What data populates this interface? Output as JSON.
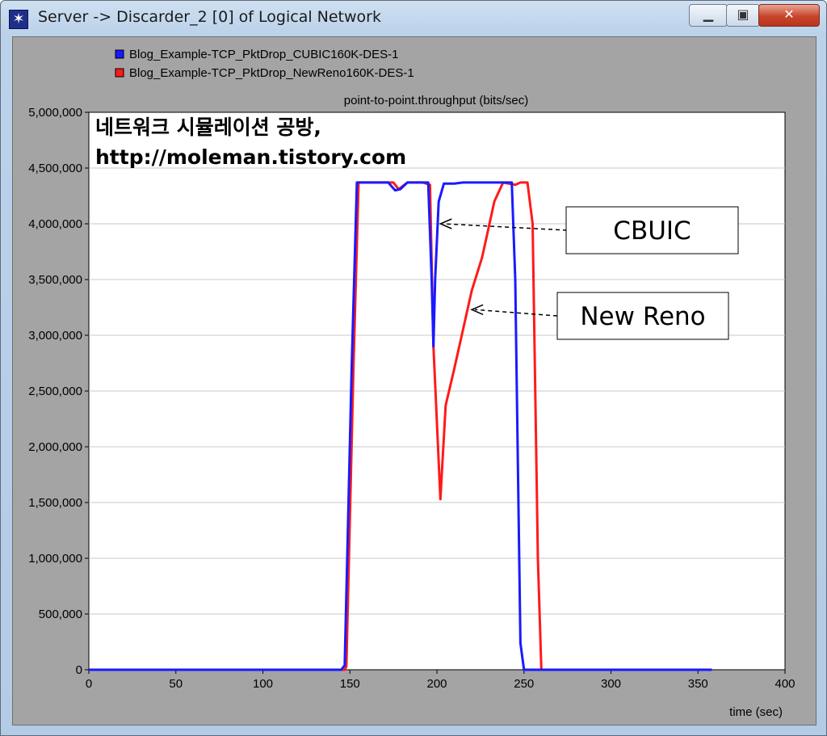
{
  "window": {
    "title": "Server -> Discarder_2 [0] of Logical Network",
    "icon": "network-star-icon",
    "buttons": {
      "minimize": "minimize-icon",
      "maximize": "maximize-icon",
      "close": "close-icon"
    }
  },
  "chart_data": {
    "type": "line",
    "title": "point-to-point.throughput (bits/sec)",
    "xlabel": "time (sec)",
    "ylabel": "",
    "xlim": [
      0,
      400
    ],
    "ylim": [
      0,
      5000000
    ],
    "x_ticks": [
      "0",
      "50",
      "100",
      "150",
      "200",
      "250",
      "300",
      "350",
      "400"
    ],
    "y_ticks": [
      "0",
      "500,000",
      "1,000,000",
      "1,500,000",
      "2,000,000",
      "2,500,000",
      "3,000,000",
      "3,500,000",
      "4,000,000",
      "4,500,000",
      "5,000,000"
    ],
    "grid": true,
    "legend_position": "top-left",
    "series": [
      {
        "name": "Blog_Example-TCP_PktDrop_NewReno160K-DES-1",
        "color": "#ff1a1a",
        "points": [
          [
            0,
            0
          ],
          [
            147,
            0
          ],
          [
            148,
            30000
          ],
          [
            152,
            2700000
          ],
          [
            155,
            4370000
          ],
          [
            175,
            4370000
          ],
          [
            178,
            4310000
          ],
          [
            183,
            4370000
          ],
          [
            192,
            4370000
          ],
          [
            196,
            4350000
          ],
          [
            198,
            2900000
          ],
          [
            202,
            1530000
          ],
          [
            205,
            2370000
          ],
          [
            210,
            2700000
          ],
          [
            215,
            3050000
          ],
          [
            220,
            3400000
          ],
          [
            226,
            3700000
          ],
          [
            233,
            4200000
          ],
          [
            238,
            4370000
          ],
          [
            245,
            4350000
          ],
          [
            248,
            4370000
          ],
          [
            252,
            4370000
          ],
          [
            255,
            4000000
          ],
          [
            258,
            1000000
          ],
          [
            260,
            0
          ],
          [
            358,
            0
          ]
        ]
      },
      {
        "name": "Blog_Example-TCP_PktDrop_CUBIC160K-DES-1",
        "color": "#1a1aff",
        "points": [
          [
            0,
            0
          ],
          [
            145,
            0
          ],
          [
            147,
            40000
          ],
          [
            151,
            2700000
          ],
          [
            154,
            4370000
          ],
          [
            172,
            4370000
          ],
          [
            176,
            4300000
          ],
          [
            179,
            4310000
          ],
          [
            183,
            4370000
          ],
          [
            195,
            4370000
          ],
          [
            197,
            3500000
          ],
          [
            198,
            2900000
          ],
          [
            199,
            3500000
          ],
          [
            201,
            4200000
          ],
          [
            204,
            4360000
          ],
          [
            210,
            4360000
          ],
          [
            215,
            4370000
          ],
          [
            243,
            4370000
          ],
          [
            245,
            3500000
          ],
          [
            248,
            240000
          ],
          [
            250,
            0
          ],
          [
            358,
            0
          ]
        ]
      }
    ],
    "legend": [
      {
        "label": "Blog_Example-TCP_PktDrop_CUBIC160K-DES-1",
        "color": "#1a1aff"
      },
      {
        "label": "Blog_Example-TCP_PktDrop_NewReno160K-DES-1",
        "color": "#ff1a1a"
      }
    ],
    "watermark": [
      "네트워크 시뮬레이션 공방,",
      "http://moleman.tistory.com"
    ],
    "annotations": [
      {
        "label": "CBUIC",
        "target": [
          202,
          4000000
        ]
      },
      {
        "label": "New Reno",
        "target": [
          220,
          3230000
        ]
      }
    ]
  }
}
